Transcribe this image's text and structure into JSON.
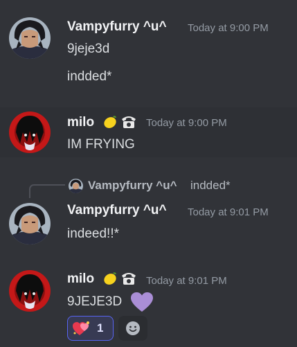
{
  "messages": [
    {
      "author": "Vampyfurry ^u^",
      "timestamp": "Today at 9:00 PM",
      "lines": [
        "9jeje3d",
        "indded*"
      ]
    },
    {
      "author": "milo",
      "author_emojis": [
        "lemon-emoji",
        "telephone-emoji"
      ],
      "timestamp": "Today at 9:00 PM",
      "lines": [
        "IM FRYING"
      ]
    },
    {
      "reply_to": {
        "author": "Vampyfurry ^u^",
        "text": "indded*"
      },
      "author": "Vampyfurry ^u^",
      "timestamp": "Today at 9:01 PM",
      "lines": [
        "indeed!!*"
      ]
    },
    {
      "author": "milo",
      "author_emojis": [
        "lemon-emoji",
        "telephone-emoji"
      ],
      "timestamp": "Today at 9:01 PM",
      "lines": [
        "9JEJE3D"
      ],
      "inline_emoji": "purple-heart-emoji",
      "reactions": [
        {
          "emoji": "hearts-on-fire-emoji",
          "count": "1",
          "selected": true
        }
      ]
    }
  ],
  "colors": {
    "background": "#313338",
    "hover_background": "#2e3035",
    "username": "#f2f3f5",
    "timestamp": "#949ba4",
    "message_text": "#dbdee1",
    "reaction_border": "#5865f2",
    "reaction_background": "#373a53"
  }
}
